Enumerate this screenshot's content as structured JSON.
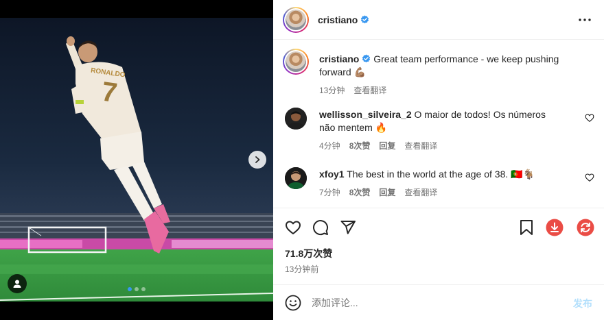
{
  "post": {
    "author": {
      "username": "cristiano",
      "verified": true
    },
    "media": {
      "carousel_count": 3,
      "active_index": 0,
      "jersey_name": "RONALDO",
      "jersey_number": "7"
    },
    "caption": {
      "username": "cristiano",
      "text": "Great team performance - we keep pushing forward 💪🏽",
      "time": "13分钟",
      "translate_label": "查看翻译"
    },
    "comments": [
      {
        "username": "wellisson_silveira_2",
        "text": "O maior de todos! Os números não mentem 🔥",
        "time": "4分钟",
        "likes": "8次赞",
        "reply_label": "回复",
        "translate_label": "查看翻译"
      },
      {
        "username": "xfoy1",
        "text": "The best in the world at the age of 38. 🇵🇹🐐",
        "time": "7分钟",
        "likes": "8次赞",
        "reply_label": "回复",
        "translate_label": "查看翻译"
      }
    ],
    "likes_label": "71.8万次赞",
    "posted_time": "13分钟前",
    "add_comment": {
      "placeholder": "添加评论...",
      "post_label": "发布"
    },
    "icons": {
      "more": "more-horizontal-icon",
      "like": "heart-icon",
      "comment": "comment-bubble-icon",
      "share": "paper-plane-icon",
      "save": "bookmark-icon",
      "download": "download-icon",
      "refresh": "refresh-icon",
      "emoji": "emoji-smile-icon",
      "next": "chevron-right-icon",
      "tagged": "user-tag-icon"
    },
    "colors": {
      "verified": "#3897f0",
      "accent_red": "#ea4c45",
      "post_button_disabled": "#b2dffc"
    }
  }
}
